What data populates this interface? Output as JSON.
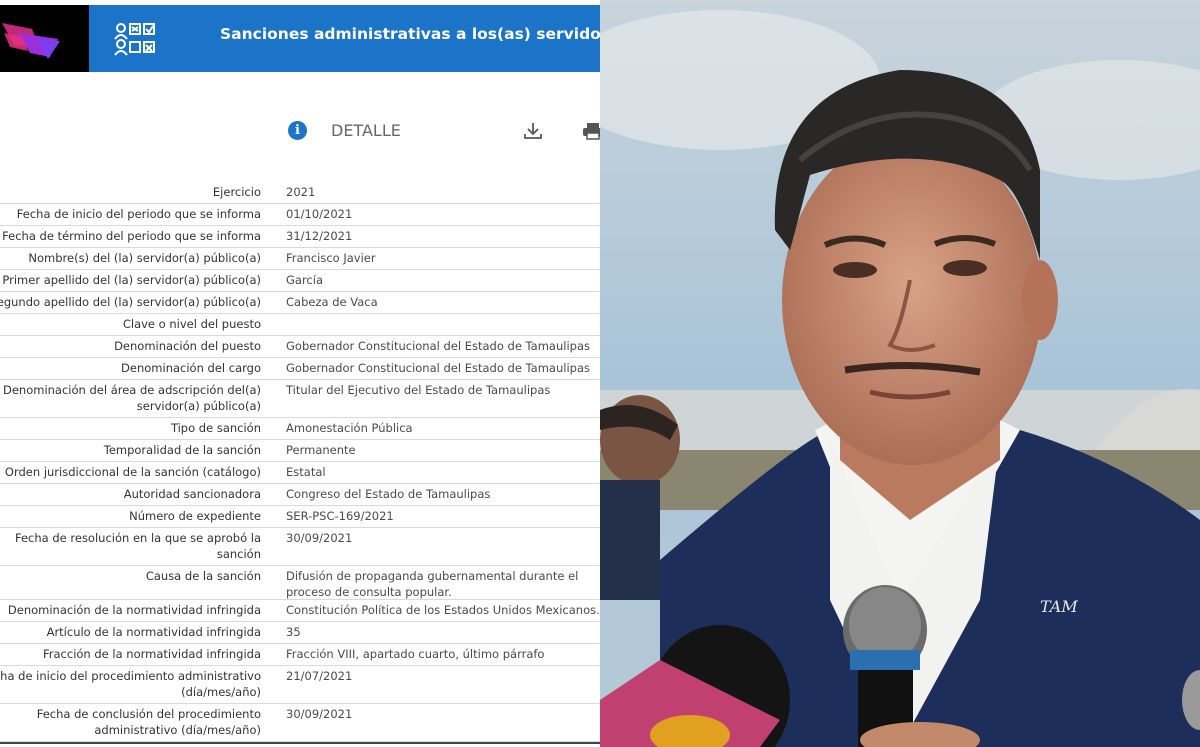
{
  "header": {
    "title": "Sanciones administrativas a los(as) servidores(as)",
    "logo_colors": [
      "#e4337a",
      "#8a2be2",
      "#b540e8"
    ],
    "accent": "#1c74c9"
  },
  "detail": {
    "info_icon": "info-icon",
    "label": "DETALLE",
    "download_icon": "download-icon",
    "print_icon": "print-icon"
  },
  "rows": [
    {
      "label": "Ejercicio",
      "value": "2021"
    },
    {
      "label": "Fecha de inicio del periodo que se informa",
      "value": "01/10/2021"
    },
    {
      "label": "Fecha de término del periodo que se informa",
      "value": "31/12/2021"
    },
    {
      "label": "Nombre(s) del (la) servidor(a) público(a)",
      "value": "Francisco Javier"
    },
    {
      "label": "Primer apellido del (la) servidor(a) público(a)",
      "value": "García"
    },
    {
      "label": "Segundo apellido del (la) servidor(a) público(a)",
      "value": "Cabeza de Vaca"
    },
    {
      "label": "Clave o nivel del puesto",
      "value": ""
    },
    {
      "label": "Denominación del puesto",
      "value": "Gobernador Constitucional del Estado de Tamaulipas"
    },
    {
      "label": "Denominación del cargo",
      "value": "Gobernador Constitucional del Estado de Tamaulipas"
    },
    {
      "label": "Denominación del área de adscripción del(a) servidor(a) público(a)",
      "value": "Titular del Ejecutivo del Estado de Tamaulipas"
    },
    {
      "label": "Tipo de sanción",
      "value": "Amonestación Pública"
    },
    {
      "label": "Temporalidad de la sanción",
      "value": "Permanente"
    },
    {
      "label": "Orden jurisdiccional de la sanción (catálogo)",
      "value": "Estatal"
    },
    {
      "label": "Autoridad sancionadora",
      "value": "Congreso del Estado de Tamaulipas"
    },
    {
      "label": "Número de expediente",
      "value": "SER-PSC-169/2021"
    },
    {
      "label": "Fecha de resolución en la que se aprobó la sanción",
      "value": "30/09/2021"
    },
    {
      "label": "Causa de la sanción",
      "value": "Difusión de propaganda gubernamental durante el proceso de consulta popular."
    },
    {
      "label": "Denominación de la normatividad infringida",
      "value": "Constitución Política de los Estados Unidos Mexicanos."
    },
    {
      "label": "Artículo de la normatividad infringida",
      "value": "35"
    },
    {
      "label": "Fracción de la normatividad infringida",
      "value": "Fracción VIII, apartado cuarto, último párrafo"
    },
    {
      "label": "Fecha de inicio del procedimiento administrativo (día/mes/año)",
      "value": "21/07/2021"
    },
    {
      "label": "Fecha de conclusión del procedimiento administrativo (día/mes/año)",
      "value": "30/09/2021"
    }
  ],
  "photo": {
    "mic_logo": "TAM",
    "sky": "#aec6d9",
    "suit": "#1b2c57"
  }
}
